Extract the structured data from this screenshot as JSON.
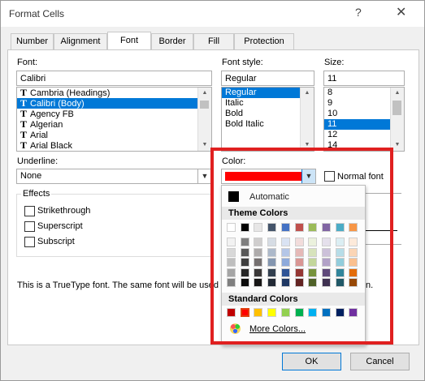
{
  "dialog": {
    "title": "Format Cells",
    "help_label": "?",
    "close_label": "✕"
  },
  "tabs": [
    {
      "label": "Number"
    },
    {
      "label": "Alignment"
    },
    {
      "label": "Font"
    },
    {
      "label": "Border"
    },
    {
      "label": "Fill"
    },
    {
      "label": "Protection"
    }
  ],
  "font": {
    "label": "Font:",
    "value": "Calibri",
    "list": [
      "Cambria (Headings)",
      "Calibri (Body)",
      "Agency FB",
      "Algerian",
      "Arial",
      "Arial Black"
    ],
    "selected": "Calibri (Body)"
  },
  "font_style": {
    "label": "Font style:",
    "value": "Regular",
    "list": [
      "Regular",
      "Italic",
      "Bold",
      "Bold Italic"
    ],
    "selected": "Regular"
  },
  "size": {
    "label": "Size:",
    "value": "11",
    "list": [
      "8",
      "9",
      "10",
      "11",
      "12",
      "14"
    ],
    "selected": "11"
  },
  "underline": {
    "label": "Underline:",
    "value": "None"
  },
  "color": {
    "label": "Color:",
    "value": "#ff0000"
  },
  "normal_font": {
    "label": "Normal font",
    "checked": false
  },
  "effects": {
    "label": "Effects",
    "strikethrough": "Strikethrough",
    "superscript": "Superscript",
    "subscript": "Subscript"
  },
  "info_text_left": "This is a TrueType font.  The same font will be used c",
  "info_text_right": "n.",
  "color_dropdown": {
    "automatic_label": "Automatic",
    "automatic_color": "#000000",
    "theme_header": "Theme Colors",
    "standard_header": "Standard Colors",
    "more_label": "More Colors...",
    "theme_top": [
      "#ffffff",
      "#000000",
      "#e7e6e6",
      "#44546a",
      "#4472c4",
      "#ed7d31",
      "#a5a5a5",
      "#ffc000",
      "#5b9bd5",
      "#70ad47"
    ],
    "theme_top_display": [
      "#ffffff",
      "#000000",
      "#e7e6e6",
      "#44546a",
      "#4472c4",
      "#c0504d",
      "#9bbb59",
      "#8064a2",
      "#4bacc6",
      "#f79646"
    ],
    "theme_shades": [
      [
        "#f2f2f2",
        "#7f7f7f",
        "#d0cece",
        "#d6dce4",
        "#dae3f3",
        "#f2dcdb",
        "#ebf1dd",
        "#e5e0ec",
        "#dbeef3",
        "#fdeada"
      ],
      [
        "#d8d8d8",
        "#595959",
        "#aeabab",
        "#adb9ca",
        "#b4c6e7",
        "#e5b9b7",
        "#d7e3bc",
        "#ccc1d9",
        "#b7dde8",
        "#fbd5b5"
      ],
      [
        "#bfbfbf",
        "#3f3f3f",
        "#757070",
        "#8496b0",
        "#8eaadb",
        "#d99694",
        "#c3d69b",
        "#b2a2c7",
        "#92cddc",
        "#fac08f"
      ],
      [
        "#a5a5a5",
        "#262626",
        "#3a3838",
        "#323f4f",
        "#2f5496",
        "#953734",
        "#76923c",
        "#5f497a",
        "#31859b",
        "#e36c09"
      ],
      [
        "#7f7f7f",
        "#0c0c0c",
        "#171616",
        "#222a35",
        "#1f3864",
        "#632423",
        "#4f6128",
        "#3f3151",
        "#205867",
        "#974806"
      ]
    ],
    "standard": [
      "#c00000",
      "#ff0000",
      "#ffc000",
      "#ffff00",
      "#92d050",
      "#00b050",
      "#00b0f0",
      "#0070c0",
      "#002060",
      "#7030a0"
    ],
    "standard_selected_index": 1
  },
  "buttons": {
    "ok": "OK",
    "cancel": "Cancel"
  },
  "annotation_color": "#e02020"
}
